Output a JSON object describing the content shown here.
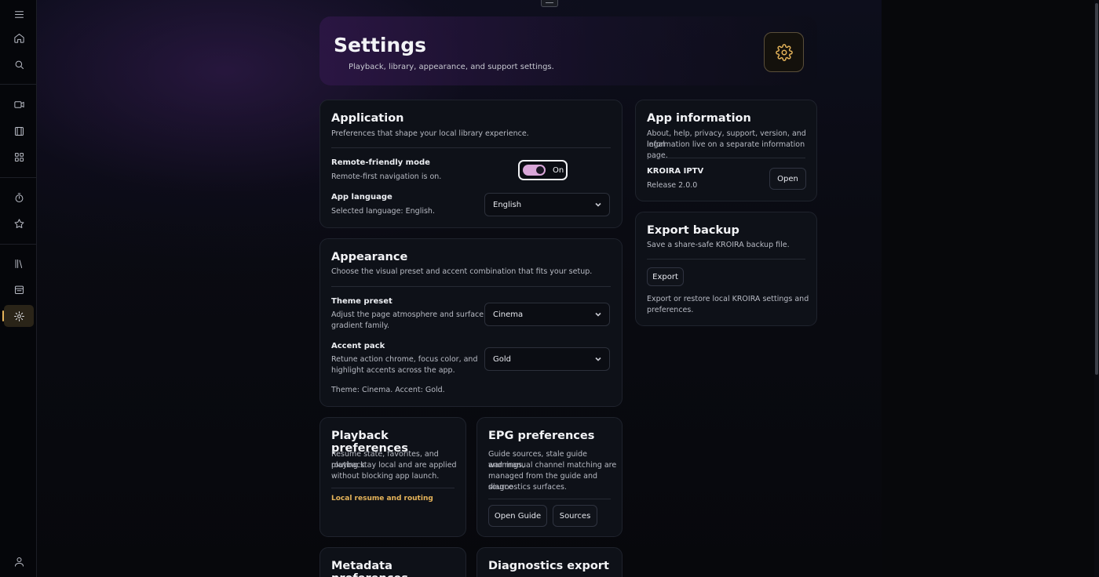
{
  "header": {
    "title": "Settings",
    "subtitle": "Playback, library, appearance, and support settings.",
    "icon": "gear-icon"
  },
  "sidebar": {
    "items": [
      {
        "name": "menu",
        "icon": "hamburger-icon"
      },
      {
        "name": "home",
        "icon": "home-icon"
      },
      {
        "name": "search",
        "icon": "search-icon"
      },
      {
        "name": "live",
        "icon": "video-camera-icon"
      },
      {
        "name": "movies",
        "icon": "film-icon"
      },
      {
        "name": "categories",
        "icon": "grid-icon"
      },
      {
        "name": "history",
        "icon": "timer-icon"
      },
      {
        "name": "favorites",
        "icon": "star-icon"
      },
      {
        "name": "library",
        "icon": "library-icon"
      },
      {
        "name": "guide",
        "icon": "calendar-icon"
      },
      {
        "name": "settings",
        "icon": "gear-icon",
        "active": true
      },
      {
        "name": "profile",
        "icon": "user-icon"
      }
    ]
  },
  "application": {
    "title": "Application",
    "desc": "Preferences that shape your local library experience.",
    "remote_label": "Remote-friendly mode",
    "remote_desc": "Remote-first navigation is on.",
    "toggle_state": "On",
    "language_label": "App language",
    "language_desc": "Selected language: English.",
    "language_value": "English"
  },
  "appearance": {
    "title": "Appearance",
    "desc": "Choose the visual preset and accent combination that fits your setup.",
    "theme_label": "Theme preset",
    "theme_desc_1": "Adjust the page atmosphere and surface",
    "theme_desc_2": "gradient family.",
    "theme_value": "Cinema",
    "accent_label": "Accent pack",
    "accent_desc_1": "Retune action chrome, focus color, and",
    "accent_desc_2": "highlight accents across the app.",
    "accent_value": "Gold",
    "summary": "Theme: Cinema. Accent: Gold."
  },
  "playback": {
    "title": "Playback preferences",
    "desc_1": "Resume state, favorites, and playback",
    "desc_2": "routing stay local and are applied",
    "desc_3": "without blocking app launch.",
    "link": "Local resume and routing"
  },
  "epg": {
    "title": "EPG preferences",
    "desc_1": "Guide sources, stale guide warnings,",
    "desc_2": "and manual channel matching are",
    "desc_3": "managed from the guide and source",
    "desc_4": "diagnostics surfaces.",
    "open_guide": "Open Guide",
    "sources": "Sources"
  },
  "metadata": {
    "title": "Metadata preferences"
  },
  "diagnostics": {
    "title": "Diagnostics export"
  },
  "app_info": {
    "title": "App information",
    "desc_1": "About, help, privacy, support, version, and legal",
    "desc_2": "information live on a separate information page.",
    "app_name": "KROIRA IPTV",
    "release": "Release 2.0.0",
    "open": "Open"
  },
  "export_backup": {
    "title": "Export backup",
    "desc": "Save a share-safe KROIRA backup file.",
    "button": "Export",
    "note_1": "Export or restore local KROIRA settings and",
    "note_2": "preferences."
  },
  "colors": {
    "accent": "#e6b45a",
    "toggle": "#d9a6d8",
    "card": "#0e1118"
  }
}
